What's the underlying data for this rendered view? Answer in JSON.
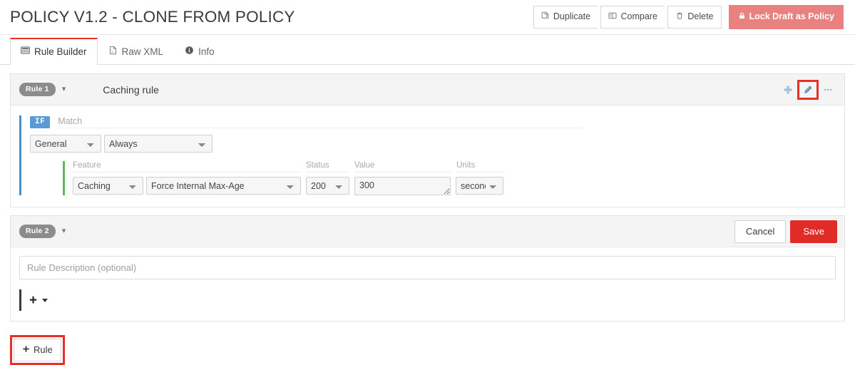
{
  "header": {
    "title": "POLICY V1.2 - CLONE FROM POLICY",
    "actions": {
      "duplicate": "Duplicate",
      "compare": "Compare",
      "delete": "Delete",
      "lock": "Lock Draft as Policy"
    },
    "icons": {
      "duplicate": "copy-icon",
      "compare": "compare-icon",
      "delete": "trash-icon",
      "lock": "lock-icon"
    },
    "colors": {
      "lock_button_bg": "#e8817f",
      "save_button_bg": "#e02b27",
      "accent_red": "#e8302a"
    }
  },
  "tabs": [
    {
      "label": "Rule Builder",
      "icon": "rule-builder-icon",
      "active": true
    },
    {
      "label": "Raw XML",
      "icon": "xml-file-icon",
      "active": false
    },
    {
      "label": "Info",
      "icon": "info-icon",
      "active": false
    }
  ],
  "rule1": {
    "badge": "Rule 1",
    "title": "Caching rule",
    "actions": {
      "add": "+",
      "edit": "pencil-icon",
      "more": "ellipsis-icon"
    },
    "condition": {
      "if_label": "IF",
      "match_label": "Match",
      "scope": "General",
      "operator": "Always"
    },
    "feature": {
      "labels": {
        "feature": "Feature",
        "status": "Status",
        "value": "Value",
        "units": "Units"
      },
      "category": "Caching",
      "action": "Force Internal Max-Age",
      "status": "200",
      "value": "300",
      "units": "seconds"
    }
  },
  "rule2": {
    "badge": "Rule 2",
    "cancel": "Cancel",
    "save": "Save",
    "description_placeholder": "Rule Description (optional)",
    "description_value": "",
    "add_label": "+"
  },
  "footer": {
    "add_rule": "Rule",
    "add_rule_icon": "plus-icon"
  }
}
